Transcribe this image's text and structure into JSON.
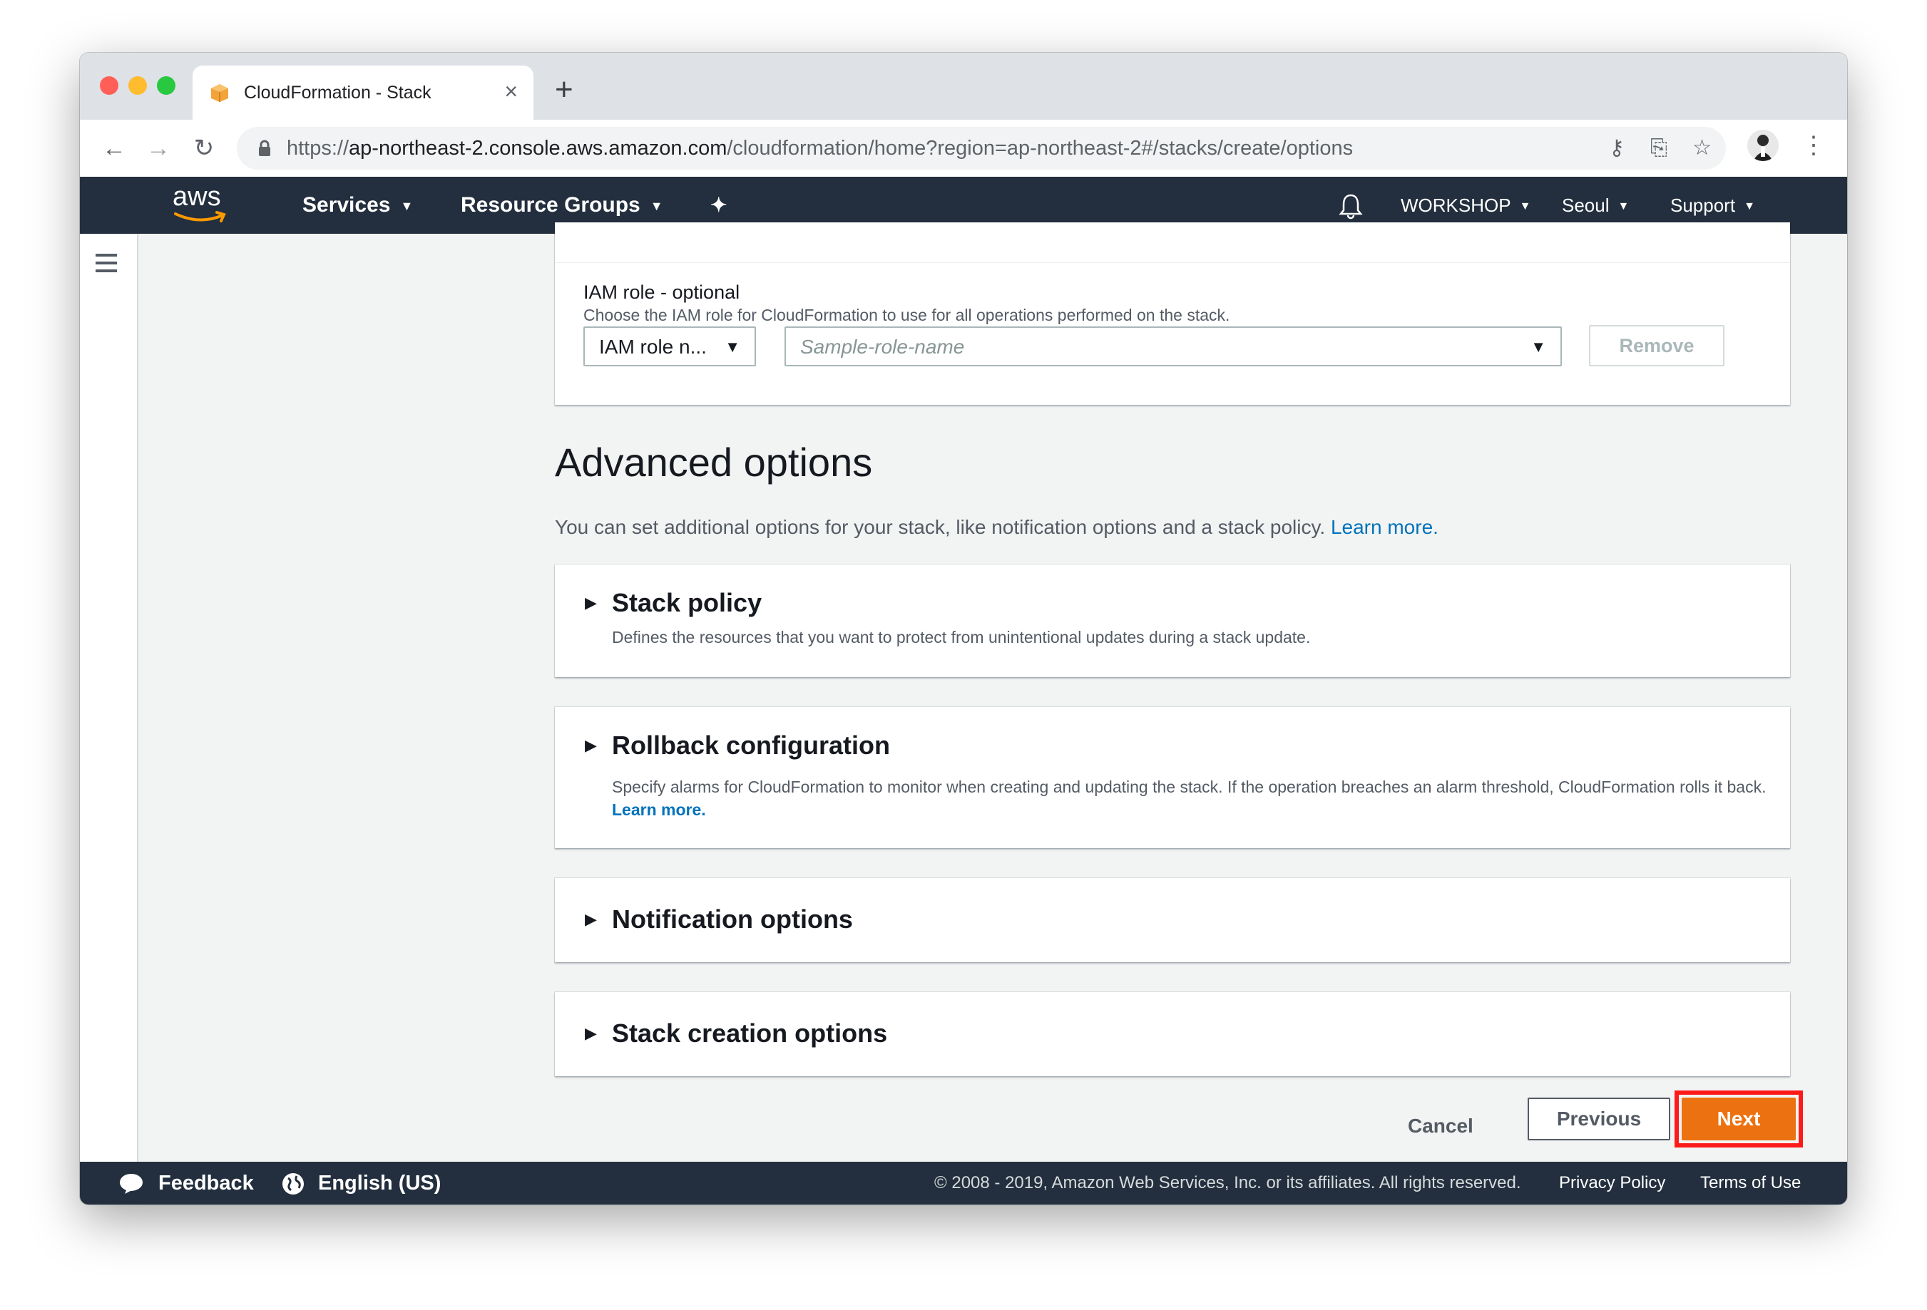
{
  "browser": {
    "tab_title": "CloudFormation - Stack",
    "new_tab": "+",
    "close": "×",
    "url_prefix": "https://",
    "url_host": "ap-northeast-2.console.aws.amazon.com",
    "url_path": "/cloudformation/home?region=ap-northeast-2#/stacks/create/options",
    "back": "←",
    "forward": "→",
    "reload": "↻",
    "key": "⚷",
    "translate": "⎘",
    "star": "☆",
    "menu": "⋮"
  },
  "awsnav": {
    "logo_text": "aws",
    "services": "Services",
    "resource_groups": "Resource Groups",
    "pin": "✦",
    "bell": "🔔",
    "account": "WORKSHOP",
    "region": "Seoul",
    "support": "Support",
    "caret": "▼"
  },
  "iam": {
    "title": "IAM role - optional",
    "description": "Choose the IAM role for CloudFormation to use for all operations performed on the stack.",
    "type_select_value": "IAM role n...",
    "role_placeholder": "Sample-role-name",
    "remove_button": "Remove",
    "arrow": "▼"
  },
  "advanced": {
    "title": "Advanced options",
    "description": "You can set additional options for your stack, like notification options and a stack policy.",
    "learn_more": "Learn more.",
    "expand_arrow": "▶",
    "sections": [
      {
        "title": "Stack policy",
        "description": "Defines the resources that you want to protect from unintentional updates during a stack update."
      },
      {
        "title": "Rollback configuration",
        "description": "Specify alarms for CloudFormation to monitor when creating and updating the stack. If the operation breaches an alarm threshold, CloudFormation rolls it back.",
        "link": "Learn more."
      },
      {
        "title": "Notification options"
      },
      {
        "title": "Stack creation options"
      }
    ]
  },
  "actions": {
    "cancel": "Cancel",
    "previous": "Previous",
    "next": "Next"
  },
  "footer": {
    "feedback": "Feedback",
    "language": "English (US)",
    "copyright": "© 2008 - 2019, Amazon Web Services, Inc. or its affiliates. All rights reserved.",
    "privacy": "Privacy Policy",
    "terms": "Terms of Use"
  },
  "colors": {
    "aws_nav": "#232f3e",
    "primary_button": "#ec7211",
    "link": "#0073bb",
    "highlight_frame": "#ff1a1a"
  }
}
